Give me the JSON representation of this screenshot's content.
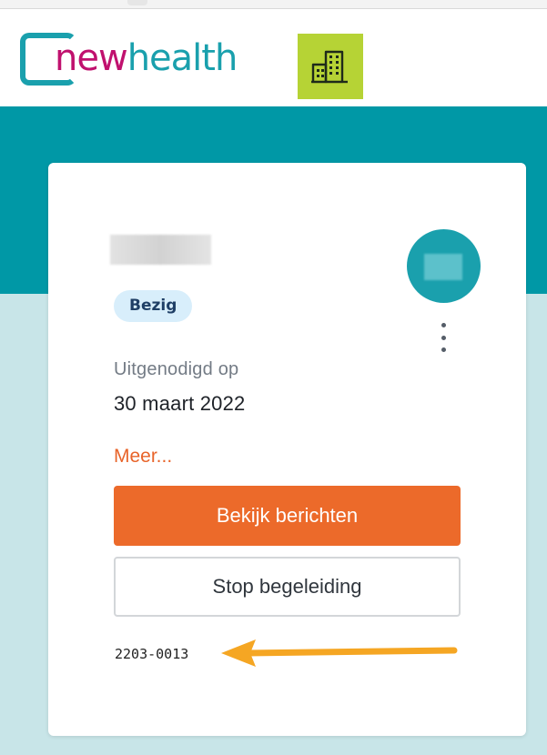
{
  "header": {
    "logo": {
      "part1": "new",
      "part2": "health"
    },
    "org_icon": "building-icon"
  },
  "card": {
    "status": "Bezig",
    "invited_label": "Uitgenodigd op",
    "invited_date": "30 maart 2022",
    "more_link": "Meer...",
    "primary_button": "Bekijk berichten",
    "secondary_button": "Stop begeleiding",
    "reference_code": "2203-0013",
    "menu_icon": "more-vertical-icon"
  },
  "colors": {
    "teal": "#0098a6",
    "logo_magenta": "#c0116e",
    "logo_teal": "#1aa0ad",
    "org_green": "#b6d335",
    "accent_orange": "#ec6a2a",
    "badge_bg": "#d8eefb",
    "annotation_arrow": "#f5a623"
  }
}
